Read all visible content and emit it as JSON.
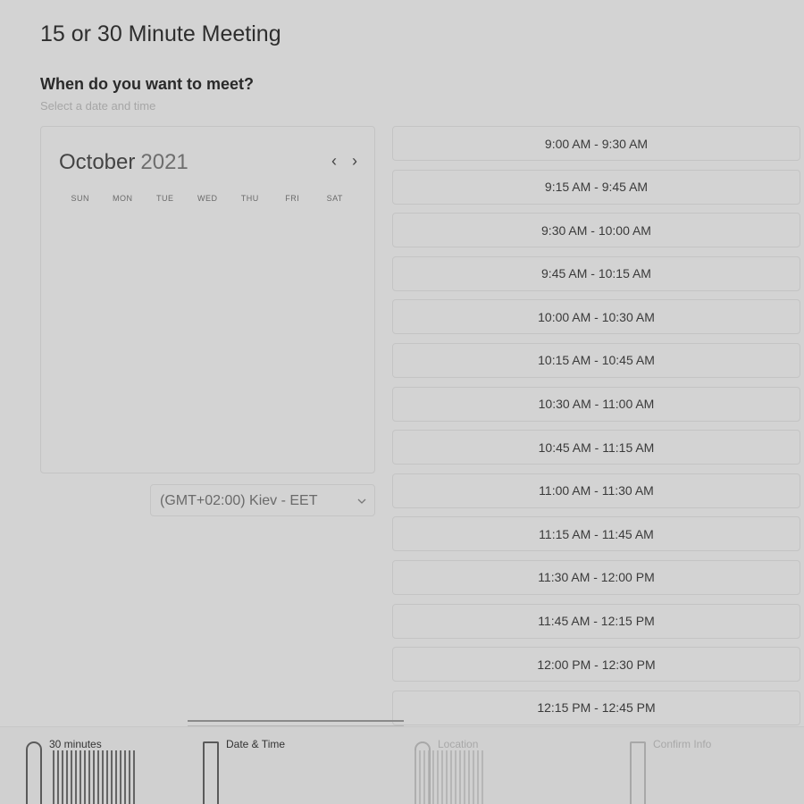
{
  "header": {
    "title": "15 or 30 Minute Meeting",
    "question": "When do you want to meet?",
    "subtitle": "Select a date and time"
  },
  "calendar": {
    "month": "October",
    "year": "2021",
    "weekdays": [
      "SUN",
      "MON",
      "TUE",
      "WED",
      "THU",
      "FRI",
      "SAT"
    ]
  },
  "timezone": {
    "selected": "(GMT+02:00) Kiev - EET"
  },
  "slots": [
    "9:00 AM - 9:30 AM",
    "9:15 AM - 9:45 AM",
    "9:30 AM - 10:00 AM",
    "9:45 AM - 10:15 AM",
    "10:00 AM - 10:30 AM",
    "10:15 AM - 10:45 AM",
    "10:30 AM - 11:00 AM",
    "10:45 AM - 11:15 AM",
    "11:00 AM - 11:30 AM",
    "11:15 AM - 11:45 AM",
    "11:30 AM - 12:00 PM",
    "11:45 AM - 12:15 PM",
    "12:00 PM - 12:30 PM",
    "12:15 PM - 12:45 PM"
  ],
  "steps": [
    {
      "label": "30 minutes",
      "state": "done",
      "icon": "clock-icon"
    },
    {
      "label": "Date & Time",
      "state": "active",
      "icon": "calendar-icon"
    },
    {
      "label": "Location",
      "state": "inactive",
      "icon": "location-icon"
    },
    {
      "label": "Confirm Info",
      "state": "inactive",
      "icon": "confirm-icon"
    }
  ],
  "colors": {
    "background": "#d3d3d3",
    "border": "#c4c4c4",
    "text": "#333333",
    "muted": "#a6a6a6"
  }
}
